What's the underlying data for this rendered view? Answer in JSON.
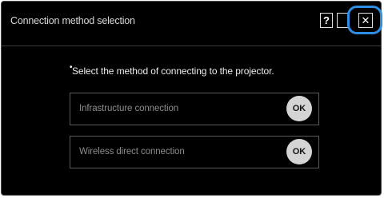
{
  "window": {
    "title": "Connection method selection",
    "help_label": "?",
    "close_label": "✕",
    "highlight_color": "#2e8ee5"
  },
  "main": {
    "bullet": "•",
    "instruction": "Select the method of connecting to the projector.",
    "options": [
      {
        "label": "Infrastructure connection",
        "button": "OK"
      },
      {
        "label": "Wireless direct connection",
        "button": "OK"
      }
    ]
  }
}
